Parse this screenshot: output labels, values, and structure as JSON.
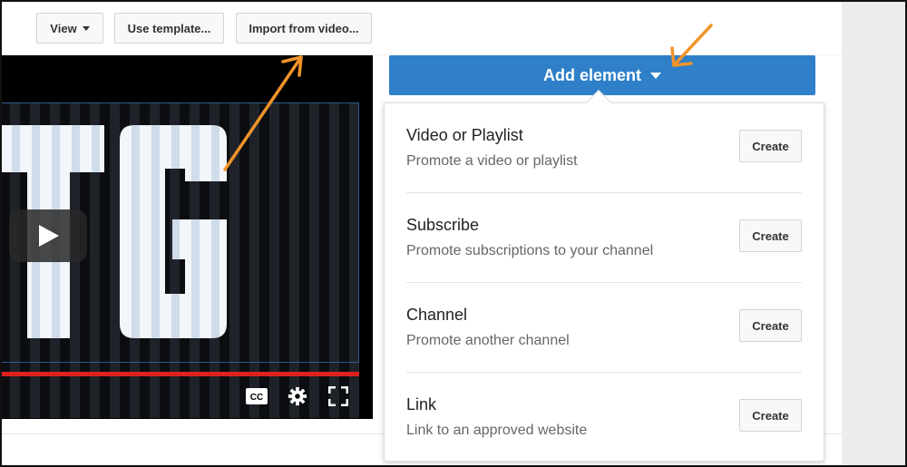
{
  "toolbar": {
    "view_label": "View",
    "template_label": "Use template...",
    "import_label": "Import from video..."
  },
  "video": {
    "logo_text": "TG",
    "controls": {
      "cc_label": "CC"
    }
  },
  "add_element": {
    "label": "Add element",
    "items": [
      {
        "title": "Video or Playlist",
        "description": "Promote a video or playlist",
        "create_label": "Create"
      },
      {
        "title": "Subscribe",
        "description": "Promote subscriptions to your channel",
        "create_label": "Create"
      },
      {
        "title": "Channel",
        "description": "Promote another channel",
        "create_label": "Create"
      },
      {
        "title": "Link",
        "description": "Link to an approved website",
        "create_label": "Create"
      }
    ]
  },
  "colors": {
    "primary_blue": "#2f80c9",
    "annotation_orange": "#f0942a",
    "progress_red": "#e02020"
  }
}
